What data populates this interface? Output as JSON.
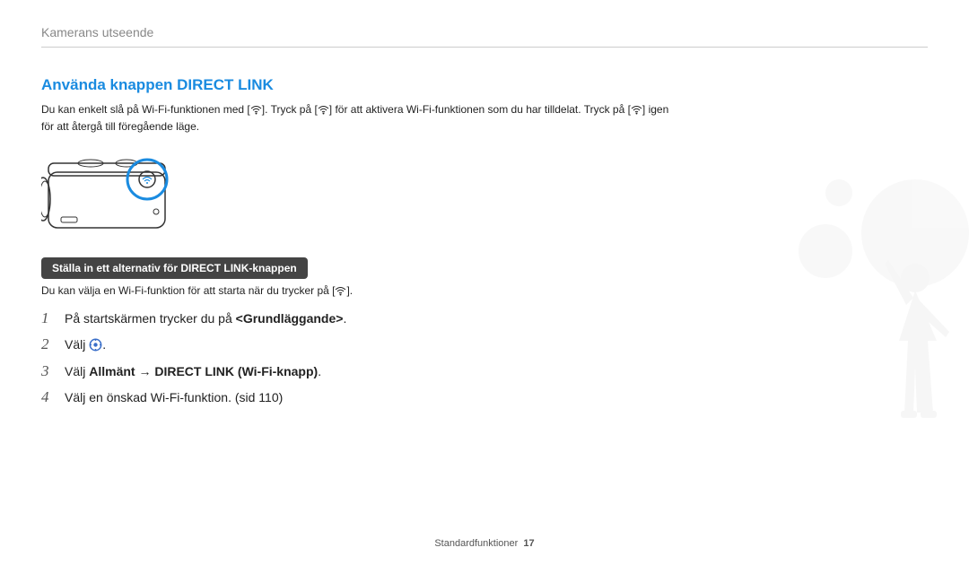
{
  "header": {
    "breadcrumb": "Kamerans utseende"
  },
  "section": {
    "title": "Använda knappen DIRECT LINK",
    "intro_pre": "Du kan enkelt slå på Wi-Fi-funktionen med [",
    "intro_mid1": "]. Tryck på [",
    "intro_mid2": "] för att aktivera Wi-Fi-funktionen som du har tilldelat. Tryck på [",
    "intro_post": "] igen för att återgå till föregående läge."
  },
  "sub": {
    "heading": "Ställa in ett alternativ för DIRECT LINK-knappen",
    "text_pre": "Du kan välja en Wi-Fi-funktion för att starta när du trycker på [",
    "text_post": "]."
  },
  "steps": [
    {
      "n": "1",
      "pre": "På startskärmen trycker du på ",
      "bold": "<Grundläggande>",
      "post": "."
    },
    {
      "n": "2",
      "pre": "Välj ",
      "icon": "settings",
      "post": "."
    },
    {
      "n": "3",
      "pre": "Välj ",
      "bold": "Allmänt → DIRECT LINK (Wi-Fi-knapp)",
      "post": "."
    },
    {
      "n": "4",
      "pre": "Välj en önskad Wi-Fi-funktion. (sid 110)"
    }
  ],
  "footer": {
    "label": "Standardfunktioner",
    "page": "17"
  }
}
